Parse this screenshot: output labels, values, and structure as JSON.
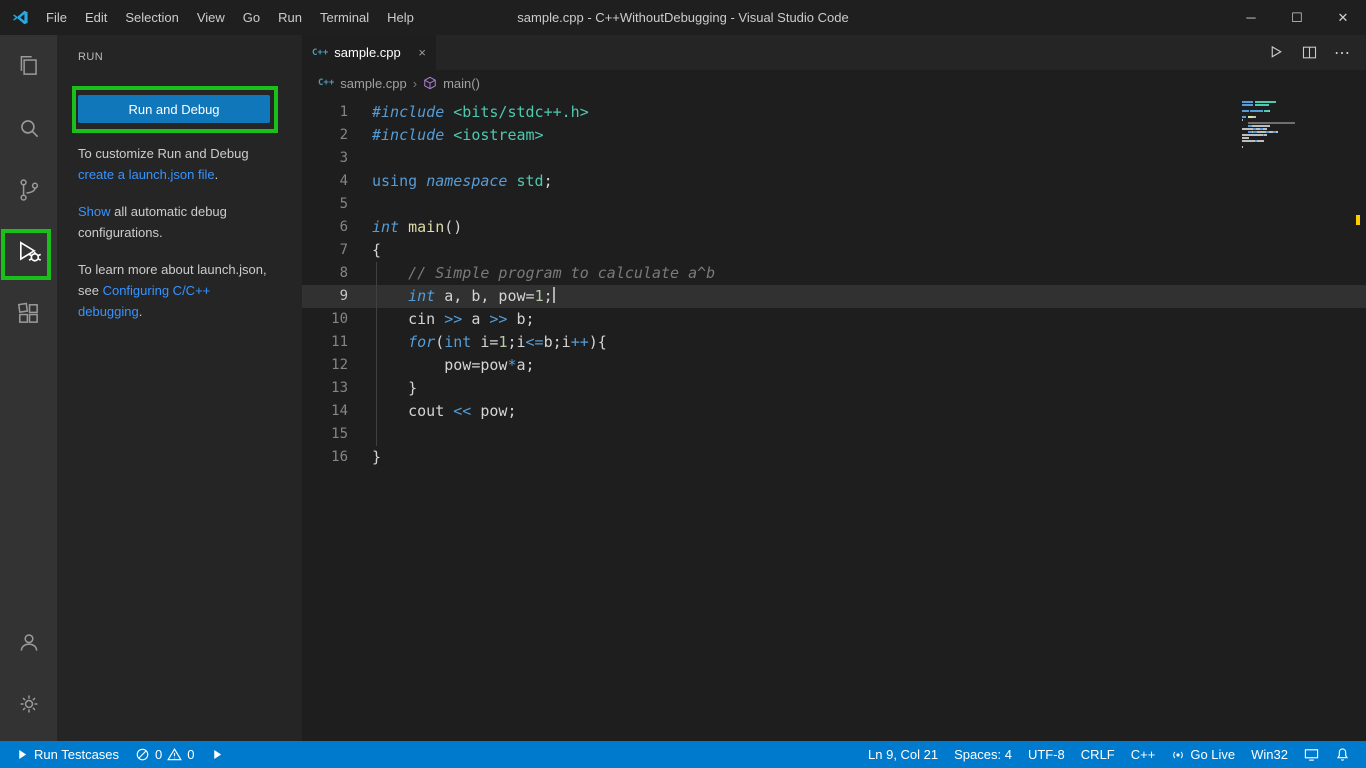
{
  "titlebar": {
    "menus": [
      "File",
      "Edit",
      "Selection",
      "View",
      "Go",
      "Run",
      "Terminal",
      "Help"
    ],
    "title": "sample.cpp - C++WithoutDebugging - Visual Studio Code",
    "window_controls": {
      "minimize": "─",
      "maximize": "☐",
      "close": "✕"
    }
  },
  "activity_bar": {
    "items": [
      "explorer",
      "search",
      "source-control",
      "run-and-debug",
      "extensions"
    ],
    "active_item": "run-and-debug",
    "bottom_items": [
      "accounts",
      "settings"
    ]
  },
  "sidebar": {
    "header": "RUN",
    "run_button_label": "Run and Debug",
    "paragraphs": [
      {
        "segments": [
          {
            "text": "To customize Run and Debug "
          },
          {
            "text": "create a launch.json file",
            "link": true
          },
          {
            "text": "."
          }
        ]
      },
      {
        "segments": [
          {
            "text": "Show",
            "link": true
          },
          {
            "text": " all automatic debug configurations."
          }
        ]
      },
      {
        "segments": [
          {
            "text": "To learn more about launch.json, see "
          },
          {
            "text": "Configuring C/C++ debugging",
            "link": true
          },
          {
            "text": "."
          }
        ]
      }
    ]
  },
  "editor": {
    "tab": {
      "label": "sample.cpp",
      "icon_label": "C++",
      "close": "×",
      "more_actions": "⋯"
    },
    "breadcrumb": {
      "file": "sample.cpp",
      "symbol": "main()",
      "separator": "›",
      "file_icon_label": "C++"
    },
    "active_line": 9,
    "cursor": {
      "line": 9,
      "col": 21
    },
    "code": [
      {
        "n": 1,
        "tokens": [
          [
            "kwi",
            "#include"
          ],
          [
            "pl",
            " "
          ],
          [
            "str",
            "<bits/stdc++.h>"
          ]
        ]
      },
      {
        "n": 2,
        "tokens": [
          [
            "kwi",
            "#include"
          ],
          [
            "pl",
            " "
          ],
          [
            "str",
            "<iostream>"
          ]
        ]
      },
      {
        "n": 3,
        "tokens": []
      },
      {
        "n": 4,
        "tokens": [
          [
            "kw",
            "using"
          ],
          [
            "pl",
            " "
          ],
          [
            "kwi",
            "namespace"
          ],
          [
            "pl",
            " "
          ],
          [
            "type",
            "std"
          ],
          [
            "pl",
            ";"
          ]
        ]
      },
      {
        "n": 5,
        "tokens": []
      },
      {
        "n": 6,
        "tokens": [
          [
            "kwi",
            "int"
          ],
          [
            "pl",
            " "
          ],
          [
            "fn",
            "main"
          ],
          [
            "pl",
            "()"
          ]
        ]
      },
      {
        "n": 7,
        "tokens": [
          [
            "pl",
            "{"
          ]
        ]
      },
      {
        "n": 8,
        "tokens": [
          [
            "pl",
            "    "
          ],
          [
            "cm",
            "// Simple program to calculate a^b"
          ]
        ]
      },
      {
        "n": 9,
        "tokens": [
          [
            "pl",
            "    "
          ],
          [
            "kwi",
            "int"
          ],
          [
            "pl",
            " a, b, pow="
          ],
          [
            "num",
            "1"
          ],
          [
            "pl",
            ";"
          ]
        ]
      },
      {
        "n": 10,
        "tokens": [
          [
            "pl",
            "    cin "
          ],
          [
            "op",
            ">>"
          ],
          [
            "pl",
            " a "
          ],
          [
            "op",
            ">>"
          ],
          [
            "pl",
            " b;"
          ]
        ]
      },
      {
        "n": 11,
        "tokens": [
          [
            "pl",
            "    "
          ],
          [
            "kwi",
            "for"
          ],
          [
            "pl",
            "("
          ],
          [
            "kw",
            "int"
          ],
          [
            "pl",
            " i="
          ],
          [
            "num",
            "1"
          ],
          [
            "pl",
            ";i"
          ],
          [
            "op",
            "<="
          ],
          [
            "pl",
            "b;i"
          ],
          [
            "op",
            "++"
          ],
          [
            "pl",
            "){"
          ]
        ]
      },
      {
        "n": 12,
        "tokens": [
          [
            "pl",
            "        pow=pow"
          ],
          [
            "op",
            "*"
          ],
          [
            "pl",
            "a;"
          ]
        ]
      },
      {
        "n": 13,
        "tokens": [
          [
            "pl",
            "    }"
          ]
        ]
      },
      {
        "n": 14,
        "tokens": [
          [
            "pl",
            "    cout "
          ],
          [
            "op",
            "<<"
          ],
          [
            "pl",
            " pow;"
          ]
        ]
      },
      {
        "n": 15,
        "tokens": []
      },
      {
        "n": 16,
        "tokens": [
          [
            "pl",
            "}"
          ]
        ]
      }
    ]
  },
  "status_bar": {
    "left": {
      "run_testcases": "Run Testcases",
      "errors": "0",
      "warnings": "0"
    },
    "right": {
      "cursor": "Ln 9, Col 21",
      "indent": "Spaces: 4",
      "encoding": "UTF-8",
      "eol": "CRLF",
      "language": "C++",
      "go_live": "Go Live",
      "platform": "Win32"
    }
  },
  "colors": {
    "status_bar": "#007ACC",
    "accent_button": "#1177BB",
    "link": "#3794FF",
    "annotation_green": "#1CBE1C",
    "modified_marker": "#FFCC00"
  }
}
